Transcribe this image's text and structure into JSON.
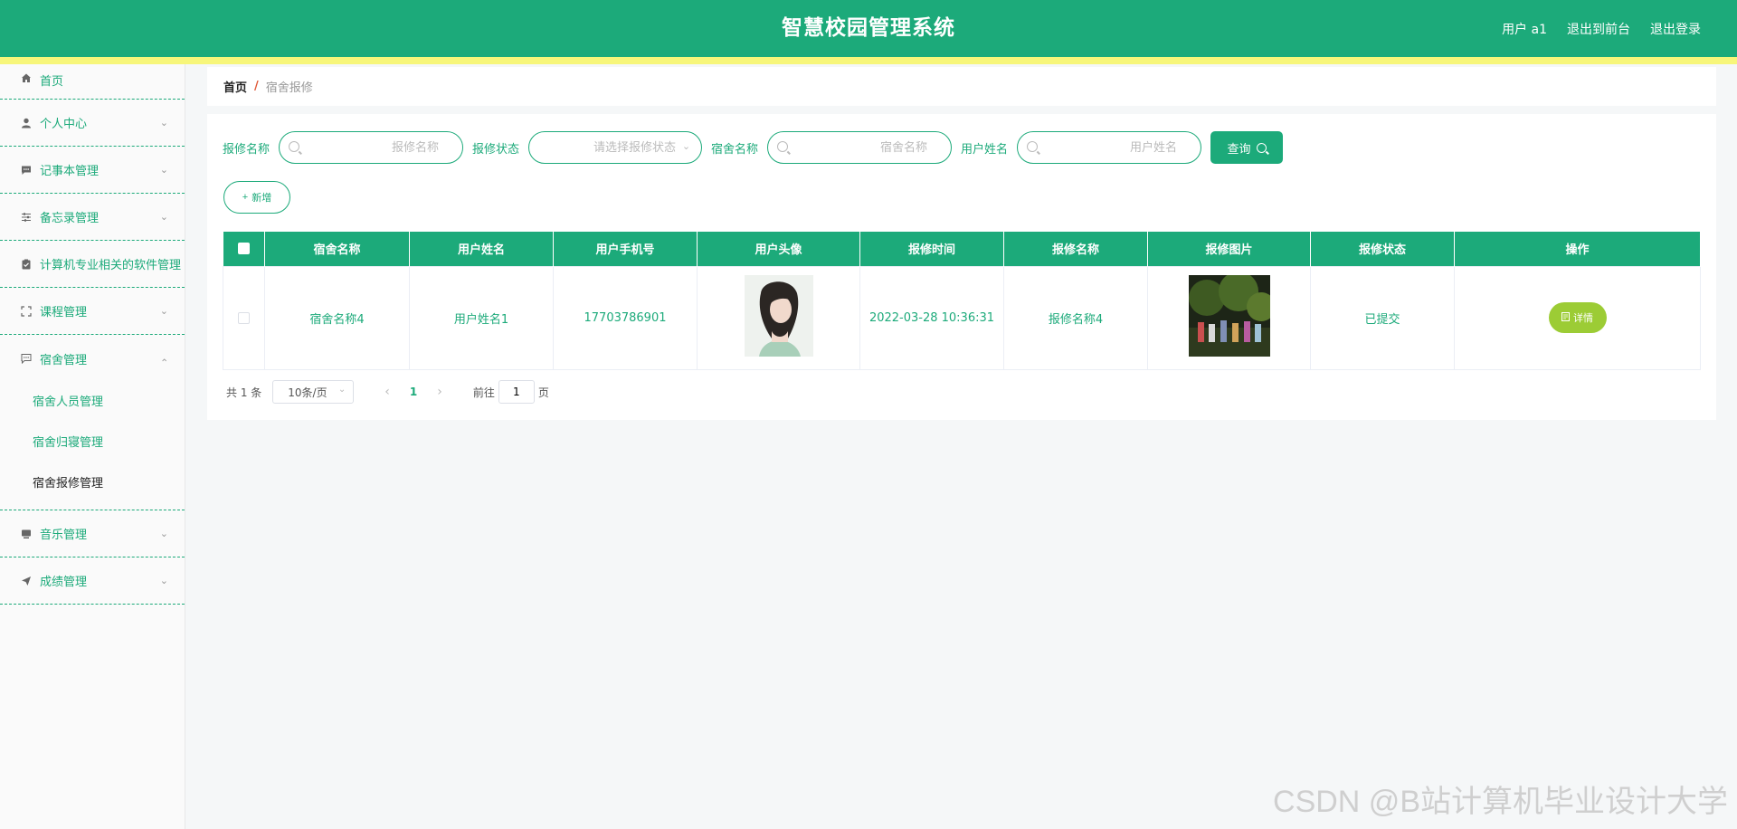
{
  "header": {
    "title": "智慧校园管理系统",
    "user": "用户 a1",
    "front": "退出到前台",
    "logout": "退出登录"
  },
  "sidebar": {
    "items": [
      {
        "label": "首页",
        "icon": "home-icon"
      },
      {
        "label": "个人中心",
        "icon": "user-icon"
      },
      {
        "label": "记事本管理",
        "icon": "chat-icon"
      },
      {
        "label": "备忘录管理",
        "icon": "sliders-icon"
      },
      {
        "label": "计算机专业相关的软件管理",
        "icon": "clipboard-icon"
      },
      {
        "label": "课程管理",
        "icon": "fullscreen-icon"
      },
      {
        "label": "宿舍管理",
        "icon": "message-icon"
      },
      {
        "label": "音乐管理",
        "icon": "monitor-icon"
      },
      {
        "label": "成绩管理",
        "icon": "send-icon"
      }
    ],
    "sub": [
      "宿舍人员管理",
      "宿舍归寝管理",
      "宿舍报修管理"
    ]
  },
  "breadcrumb": {
    "home": "首页",
    "sep": "/",
    "current": "宿舍报修"
  },
  "search": {
    "label1": "报修名称",
    "ph1": "报修名称",
    "label2": "报修状态",
    "ph2": "请选择报修状态",
    "label3": "宿舍名称",
    "ph3": "宿舍名称",
    "label4": "用户姓名",
    "ph4": "用户姓名",
    "query": "查询"
  },
  "add_label": "新增",
  "table": {
    "headers": [
      "宿舍名称",
      "用户姓名",
      "用户手机号",
      "用户头像",
      "报修时间",
      "报修名称",
      "报修图片",
      "报修状态",
      "操作"
    ],
    "rows": [
      {
        "dorm": "宿舍名称4",
        "name": "用户姓名1",
        "phone": "17703786901",
        "time": "2022-03-28 10:36:31",
        "repair": "报修名称4",
        "status": "已提交",
        "action": "详情"
      }
    ]
  },
  "pager": {
    "total": "共 1 条",
    "size": "10条/页",
    "page": "1",
    "goto": "前往",
    "goto_value": "1",
    "unit": "页"
  },
  "watermark": "CSDN @B站计算机毕业设计大学",
  "colors": {
    "primary": "#1caa7a",
    "stripe": "#f7f67a",
    "detail": "#9ccc35"
  }
}
